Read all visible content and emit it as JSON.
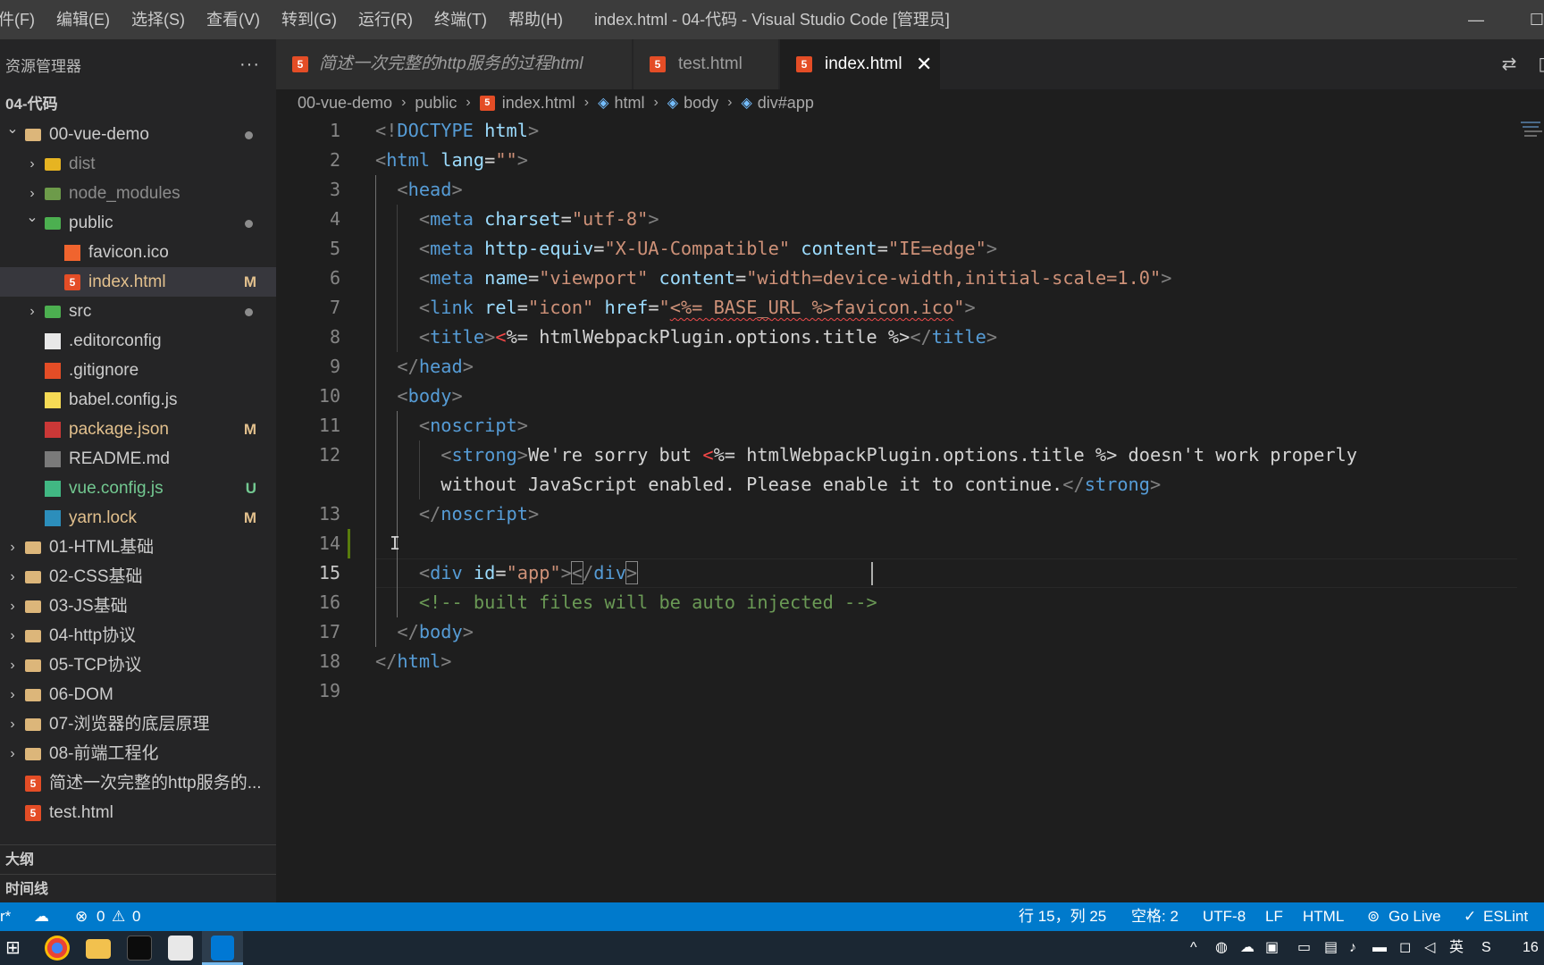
{
  "window": {
    "title": "index.html - 04-代码 - Visual Studio Code [管理员]",
    "minimize_glyph": "—",
    "maximize_glyph": "☐"
  },
  "menu": [
    "件(F)",
    "编辑(E)",
    "选择(S)",
    "查看(V)",
    "转到(G)",
    "运行(R)",
    "终端(T)",
    "帮助(H)"
  ],
  "explorer": {
    "title": "资源管理器",
    "more": "···",
    "workspace": "04-代码",
    "tree": [
      {
        "label": "00-vue-demo",
        "icon": "folder-open-icon",
        "expanded": true,
        "dot": true
      },
      {
        "label": "dist",
        "icon": "folder-dist-icon",
        "dim": true
      },
      {
        "label": "node_modules",
        "icon": "folder-node-icon",
        "dim": true
      },
      {
        "label": "public",
        "icon": "folder-public-icon",
        "expanded": true,
        "dot": true
      },
      {
        "label": "favicon.ico",
        "icon": "favicon-icon"
      },
      {
        "label": "index.html",
        "icon": "html5-icon",
        "badge": "M",
        "selected": true
      },
      {
        "label": "src",
        "icon": "folder-src-icon",
        "dot": true
      },
      {
        "label": ".editorconfig",
        "icon": "editorconfig-icon"
      },
      {
        "label": ".gitignore",
        "icon": "git-icon"
      },
      {
        "label": "babel.config.js",
        "icon": "babel-icon"
      },
      {
        "label": "package.json",
        "icon": "npm-icon",
        "badge": "M"
      },
      {
        "label": "README.md",
        "icon": "markdown-icon"
      },
      {
        "label": "vue.config.js",
        "icon": "vue-icon",
        "badge": "U"
      },
      {
        "label": "yarn.lock",
        "icon": "yarn-icon",
        "badge": "M"
      },
      {
        "label": "01-HTML基础",
        "icon": "folder-icon"
      },
      {
        "label": "02-CSS基础",
        "icon": "folder-icon"
      },
      {
        "label": "03-JS基础",
        "icon": "folder-icon"
      },
      {
        "label": "04-http协议",
        "icon": "folder-icon"
      },
      {
        "label": "05-TCP协议",
        "icon": "folder-icon"
      },
      {
        "label": "06-DOM",
        "icon": "folder-icon"
      },
      {
        "label": "07-浏览器的底层原理",
        "icon": "folder-icon"
      },
      {
        "label": "08-前端工程化",
        "icon": "folder-icon"
      },
      {
        "label": "简述一次完整的http服务的...",
        "icon": "html5-icon"
      },
      {
        "label": "test.html",
        "icon": "html5-icon"
      }
    ],
    "outline": "大纲",
    "timeline": "时间线"
  },
  "tabs": [
    {
      "label": "简述一次完整的http服务的过程html",
      "italic": true
    },
    {
      "label": "test.html"
    },
    {
      "label": "index.html",
      "active": true,
      "close": "✕"
    }
  ],
  "breadcrumb": [
    "00-vue-demo",
    "public",
    "index.html",
    "html",
    "body",
    "div#app"
  ],
  "editor": {
    "line_numbers": [
      "1",
      "2",
      "3",
      "4",
      "5",
      "6",
      "7",
      "8",
      "9",
      "10",
      "11",
      "12",
      "",
      "13",
      "14",
      "15",
      "16",
      "17",
      "18",
      "19"
    ],
    "current_line": "15",
    "lines": [
      [
        [
          "b",
          "<!"
        ],
        [
          "t",
          "DOCTYPE"
        ],
        [
          "x",
          " "
        ],
        [
          "a",
          "html"
        ],
        [
          "b",
          ">"
        ]
      ],
      [
        [
          "b",
          "<"
        ],
        [
          "t",
          "html"
        ],
        [
          "x",
          " "
        ],
        [
          "a",
          "lang"
        ],
        [
          "x",
          "="
        ],
        [
          "s",
          "\"\""
        ],
        [
          "b",
          ">"
        ]
      ],
      [
        [
          "x",
          "  "
        ],
        [
          "b",
          "<"
        ],
        [
          "t",
          "head"
        ],
        [
          "b",
          ">"
        ]
      ],
      [
        [
          "x",
          "    "
        ],
        [
          "b",
          "<"
        ],
        [
          "t",
          "meta"
        ],
        [
          "x",
          " "
        ],
        [
          "a",
          "charset"
        ],
        [
          "x",
          "="
        ],
        [
          "s",
          "\"utf-8\""
        ],
        [
          "b",
          ">"
        ]
      ],
      [
        [
          "x",
          "    "
        ],
        [
          "b",
          "<"
        ],
        [
          "t",
          "meta"
        ],
        [
          "x",
          " "
        ],
        [
          "a",
          "http-equiv"
        ],
        [
          "x",
          "="
        ],
        [
          "s",
          "\"X-UA-Compatible\""
        ],
        [
          "x",
          " "
        ],
        [
          "a",
          "content"
        ],
        [
          "x",
          "="
        ],
        [
          "s",
          "\"IE=edge\""
        ],
        [
          "b",
          ">"
        ]
      ],
      [
        [
          "x",
          "    "
        ],
        [
          "b",
          "<"
        ],
        [
          "t",
          "meta"
        ],
        [
          "x",
          " "
        ],
        [
          "a",
          "name"
        ],
        [
          "x",
          "="
        ],
        [
          "s",
          "\"viewport\""
        ],
        [
          "x",
          " "
        ],
        [
          "a",
          "content"
        ],
        [
          "x",
          "="
        ],
        [
          "s",
          "\"width=device-width,initial-scale=1.0\""
        ],
        [
          "b",
          ">"
        ]
      ],
      [
        [
          "x",
          "    "
        ],
        [
          "b",
          "<"
        ],
        [
          "t",
          "link"
        ],
        [
          "x",
          " "
        ],
        [
          "a",
          "rel"
        ],
        [
          "x",
          "="
        ],
        [
          "s",
          "\"icon\""
        ],
        [
          "x",
          " "
        ],
        [
          "a",
          "href"
        ],
        [
          "x",
          "="
        ],
        [
          "s",
          "\""
        ],
        [
          "sq",
          "<%= BASE_URL %>favicon.ico"
        ],
        [
          "s",
          "\""
        ],
        [
          "b",
          ">"
        ]
      ],
      [
        [
          "x",
          "    "
        ],
        [
          "b",
          "<"
        ],
        [
          "t",
          "title"
        ],
        [
          "b",
          ">"
        ],
        [
          "r",
          "<"
        ],
        [
          "x",
          "%= htmlWebpackPlugin.options.title %>"
        ],
        [
          "b",
          "</"
        ],
        [
          "t",
          "title"
        ],
        [
          "b",
          ">"
        ]
      ],
      [
        [
          "x",
          "  "
        ],
        [
          "b",
          "</"
        ],
        [
          "t",
          "head"
        ],
        [
          "b",
          ">"
        ]
      ],
      [
        [
          "x",
          "  "
        ],
        [
          "b",
          "<"
        ],
        [
          "t",
          "body"
        ],
        [
          "b",
          ">"
        ]
      ],
      [
        [
          "x",
          "    "
        ],
        [
          "b",
          "<"
        ],
        [
          "t",
          "noscript"
        ],
        [
          "b",
          ">"
        ]
      ],
      [
        [
          "x",
          "      "
        ],
        [
          "b",
          "<"
        ],
        [
          "t",
          "strong"
        ],
        [
          "b",
          ">"
        ],
        [
          "x",
          "We're sorry but "
        ],
        [
          "r",
          "<"
        ],
        [
          "x",
          "%= htmlWebpackPlugin.options.title %> doesn't work properly"
        ]
      ],
      [
        [
          "x",
          "      without JavaScript enabled. Please enable it to continue."
        ],
        [
          "b",
          "</"
        ],
        [
          "t",
          "strong"
        ],
        [
          "b",
          ">"
        ]
      ],
      [
        [
          "x",
          "    "
        ],
        [
          "b",
          "</"
        ],
        [
          "t",
          "noscript"
        ],
        [
          "b",
          ">"
        ]
      ],
      [
        [
          "x",
          ""
        ]
      ],
      [
        [
          "x",
          "    "
        ],
        [
          "b",
          "<"
        ],
        [
          "t",
          "div"
        ],
        [
          "x",
          " "
        ],
        [
          "a",
          "id"
        ],
        [
          "x",
          "="
        ],
        [
          "s",
          "\"app\""
        ],
        [
          "b",
          ">"
        ],
        [
          "m",
          "<"
        ],
        [
          "b",
          "/"
        ],
        [
          "t",
          "div"
        ],
        [
          "m",
          ">"
        ]
      ],
      [
        [
          "x",
          "    "
        ],
        [
          "c",
          "<!-- built files will be auto injected -->"
        ]
      ],
      [
        [
          "x",
          "  "
        ],
        [
          "b",
          "</"
        ],
        [
          "t",
          "body"
        ],
        [
          "b",
          ">"
        ]
      ],
      [
        [
          "b",
          "</"
        ],
        [
          "t",
          "html"
        ],
        [
          "b",
          ">"
        ]
      ],
      [
        [
          "x",
          ""
        ]
      ]
    ]
  },
  "statusbar": {
    "left_fragment": "r*",
    "sync_icon": "cloud-sync-icon",
    "errors": "0",
    "warnings": "0",
    "position": "行 15，列 25",
    "spaces": "空格: 2",
    "encoding": "UTF-8",
    "eol": "LF",
    "language": "HTML",
    "golive": "Go Live",
    "eslint": "ESLint"
  },
  "taskbar": {
    "ime": "英",
    "clock_fragment": "16"
  },
  "colors": {
    "accent": "#007acc",
    "html_icon": "#e44d26",
    "folder": "#dcb67a",
    "modified": "#e2c08d",
    "untracked": "#73c991"
  }
}
